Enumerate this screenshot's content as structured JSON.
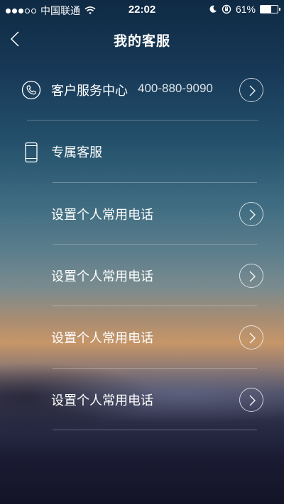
{
  "status_bar": {
    "carrier": "中国联通",
    "time": "22:02",
    "battery": "61%",
    "battery_level": 0.61
  },
  "nav": {
    "title": "我的客服"
  },
  "service_center": {
    "label": "客户服务中心",
    "phone": "400-880-9090"
  },
  "exclusive": {
    "label": "专属客服"
  },
  "items": [
    {
      "label": "设置个人常用电话"
    },
    {
      "label": "设置个人常用电话"
    },
    {
      "label": "设置个人常用电话"
    },
    {
      "label": "设置个人常用电话"
    }
  ],
  "icons": {
    "back": "chevron-left-icon",
    "phone": "phone-icon",
    "mobile": "mobile-phone-icon",
    "arrow": "chevron-right-icon"
  }
}
